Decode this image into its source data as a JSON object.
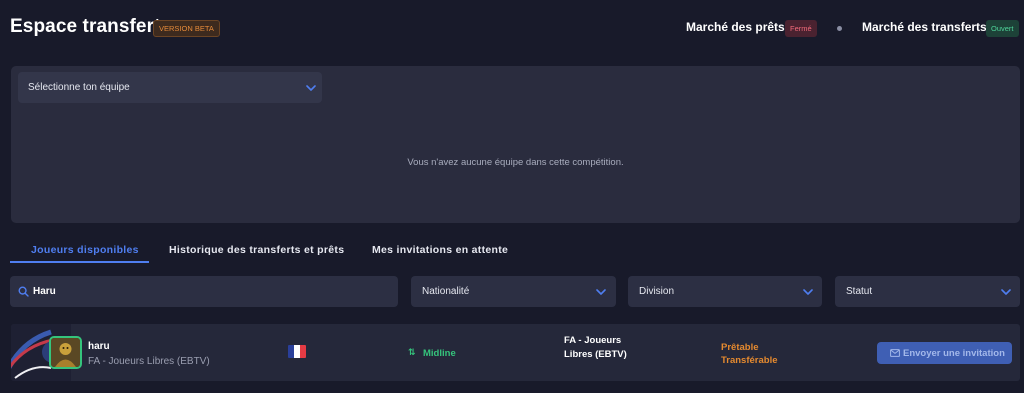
{
  "header": {
    "title": "Espace transfert",
    "beta_badge": "VERSION BETA",
    "loans_market": {
      "label": "Marché des prêts",
      "status": "Fermé"
    },
    "transfers_market": {
      "label": "Marché des transferts",
      "status": "Ouvert"
    }
  },
  "team_panel": {
    "select_label": "Sélectionne ton équipe",
    "empty_message": "Vous n'avez aucune équipe dans cette compétition."
  },
  "tabs": [
    {
      "label": "Joueurs disponibles",
      "active": true
    },
    {
      "label": "Historique des transferts et prêts",
      "active": false
    },
    {
      "label": "Mes invitations en attente",
      "active": false
    }
  ],
  "filters": {
    "search_value": "Haru",
    "nationality": "Nationalité",
    "division": "Division",
    "status": "Statut"
  },
  "players": [
    {
      "name": "haru",
      "team": "FA - Joueurs Libres (EBTV)",
      "nationality_flag": "france-flag",
      "role_icon": "⇅",
      "role": "Midline",
      "division": "FA - Joueurs Libres (EBTV)",
      "status": [
        "Prêtable",
        "Transférable"
      ],
      "invite_label": "Envoyer une invitation"
    }
  ],
  "colors": {
    "accent": "#4f7ef0",
    "open": "#4fd39a",
    "closed": "#f06a7a",
    "status_orange": "#e58a2f",
    "role_green": "#35c47c"
  }
}
